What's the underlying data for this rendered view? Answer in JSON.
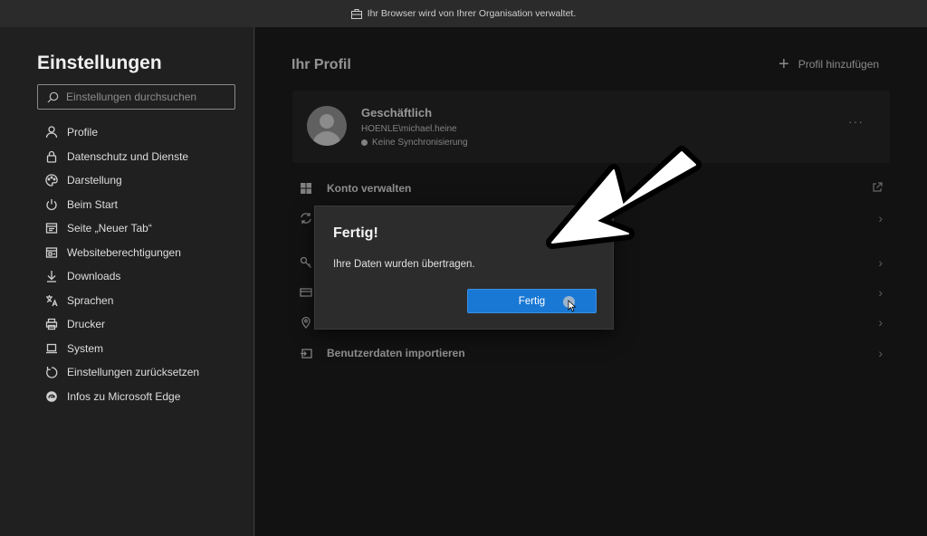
{
  "banner": {
    "text": "Ihr Browser wird von Ihrer Organisation verwaltet.",
    "icon": "briefcase-icon"
  },
  "sidebar": {
    "title": "Einstellungen",
    "search_placeholder": "Einstellungen durchsuchen",
    "items": [
      {
        "label": "Profile",
        "icon": "person-icon"
      },
      {
        "label": "Datenschutz und Dienste",
        "icon": "lock-icon"
      },
      {
        "label": "Darstellung",
        "icon": "palette-icon"
      },
      {
        "label": "Beim Start",
        "icon": "power-icon"
      },
      {
        "label": "Seite „Neuer Tab“",
        "icon": "new-tab-icon"
      },
      {
        "label": "Websiteberechtigungen",
        "icon": "site-permissions-icon"
      },
      {
        "label": "Downloads",
        "icon": "download-icon"
      },
      {
        "label": "Sprachen",
        "icon": "languages-icon"
      },
      {
        "label": "Drucker",
        "icon": "printer-icon"
      },
      {
        "label": "System",
        "icon": "laptop-icon"
      },
      {
        "label": "Einstellungen zurücksetzen",
        "icon": "reset-icon"
      },
      {
        "label": "Infos zu Microsoft Edge",
        "icon": "edge-icon"
      }
    ]
  },
  "main": {
    "title": "Ihr Profil",
    "add_profile": "Profil hinzufügen",
    "profile": {
      "name": "Geschäftlich",
      "user": "HOENLE\\michael.heine",
      "sync": "Keine Synchronisierung"
    },
    "rows": [
      {
        "label": "Konto verwalten",
        "icon": "windows-grid-icon",
        "trail": "external-link-icon"
      },
      {
        "label": "",
        "icon": "sync-icon",
        "trail": "chevron-right-icon"
      },
      {
        "label": "",
        "icon": "key-icon",
        "trail": "chevron-right-icon"
      },
      {
        "label": "",
        "icon": "card-icon",
        "trail": "chevron-right-icon"
      },
      {
        "label": "",
        "icon": "location-icon",
        "trail": "chevron-right-icon"
      },
      {
        "label": "Benutzerdaten importieren",
        "icon": "import-icon",
        "trail": "chevron-right-icon"
      }
    ]
  },
  "dialog": {
    "title": "Fertig!",
    "message": "Ihre Daten wurden übertragen.",
    "button": "Fertig"
  },
  "colors": {
    "accent": "#1978d4",
    "background": "#1d1d1d",
    "dialog": "#2c2c2c"
  }
}
